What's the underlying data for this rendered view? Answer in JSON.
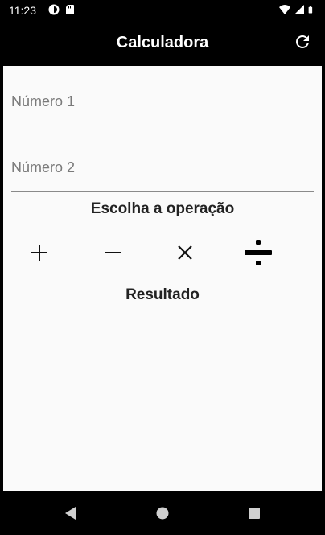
{
  "status_bar": {
    "time": "11:23",
    "icons": [
      "data-saver-icon",
      "sd-card-icon",
      "wifi-icon",
      "signal-icon",
      "battery-icon"
    ]
  },
  "app_bar": {
    "title": "Calculadora",
    "refresh_icon": "refresh-icon"
  },
  "form": {
    "number1_placeholder": "Número 1",
    "number2_placeholder": "Número 2",
    "choose_operation_label": "Escolha a operação",
    "operations": [
      {
        "name": "add",
        "icon": "plus-icon"
      },
      {
        "name": "subtract",
        "icon": "minus-icon"
      },
      {
        "name": "multiply",
        "icon": "times-icon"
      },
      {
        "name": "divide",
        "icon": "divide-icon"
      }
    ],
    "result_label": "Resultado"
  },
  "nav_bar": {
    "icons": [
      "back-icon",
      "home-icon",
      "recents-icon"
    ]
  },
  "colors": {
    "app_bar_bg": "#000000",
    "content_bg": "#fafafa",
    "text": "#222222",
    "placeholder": "#7a7a7a",
    "divider": "#8a8a8a"
  }
}
